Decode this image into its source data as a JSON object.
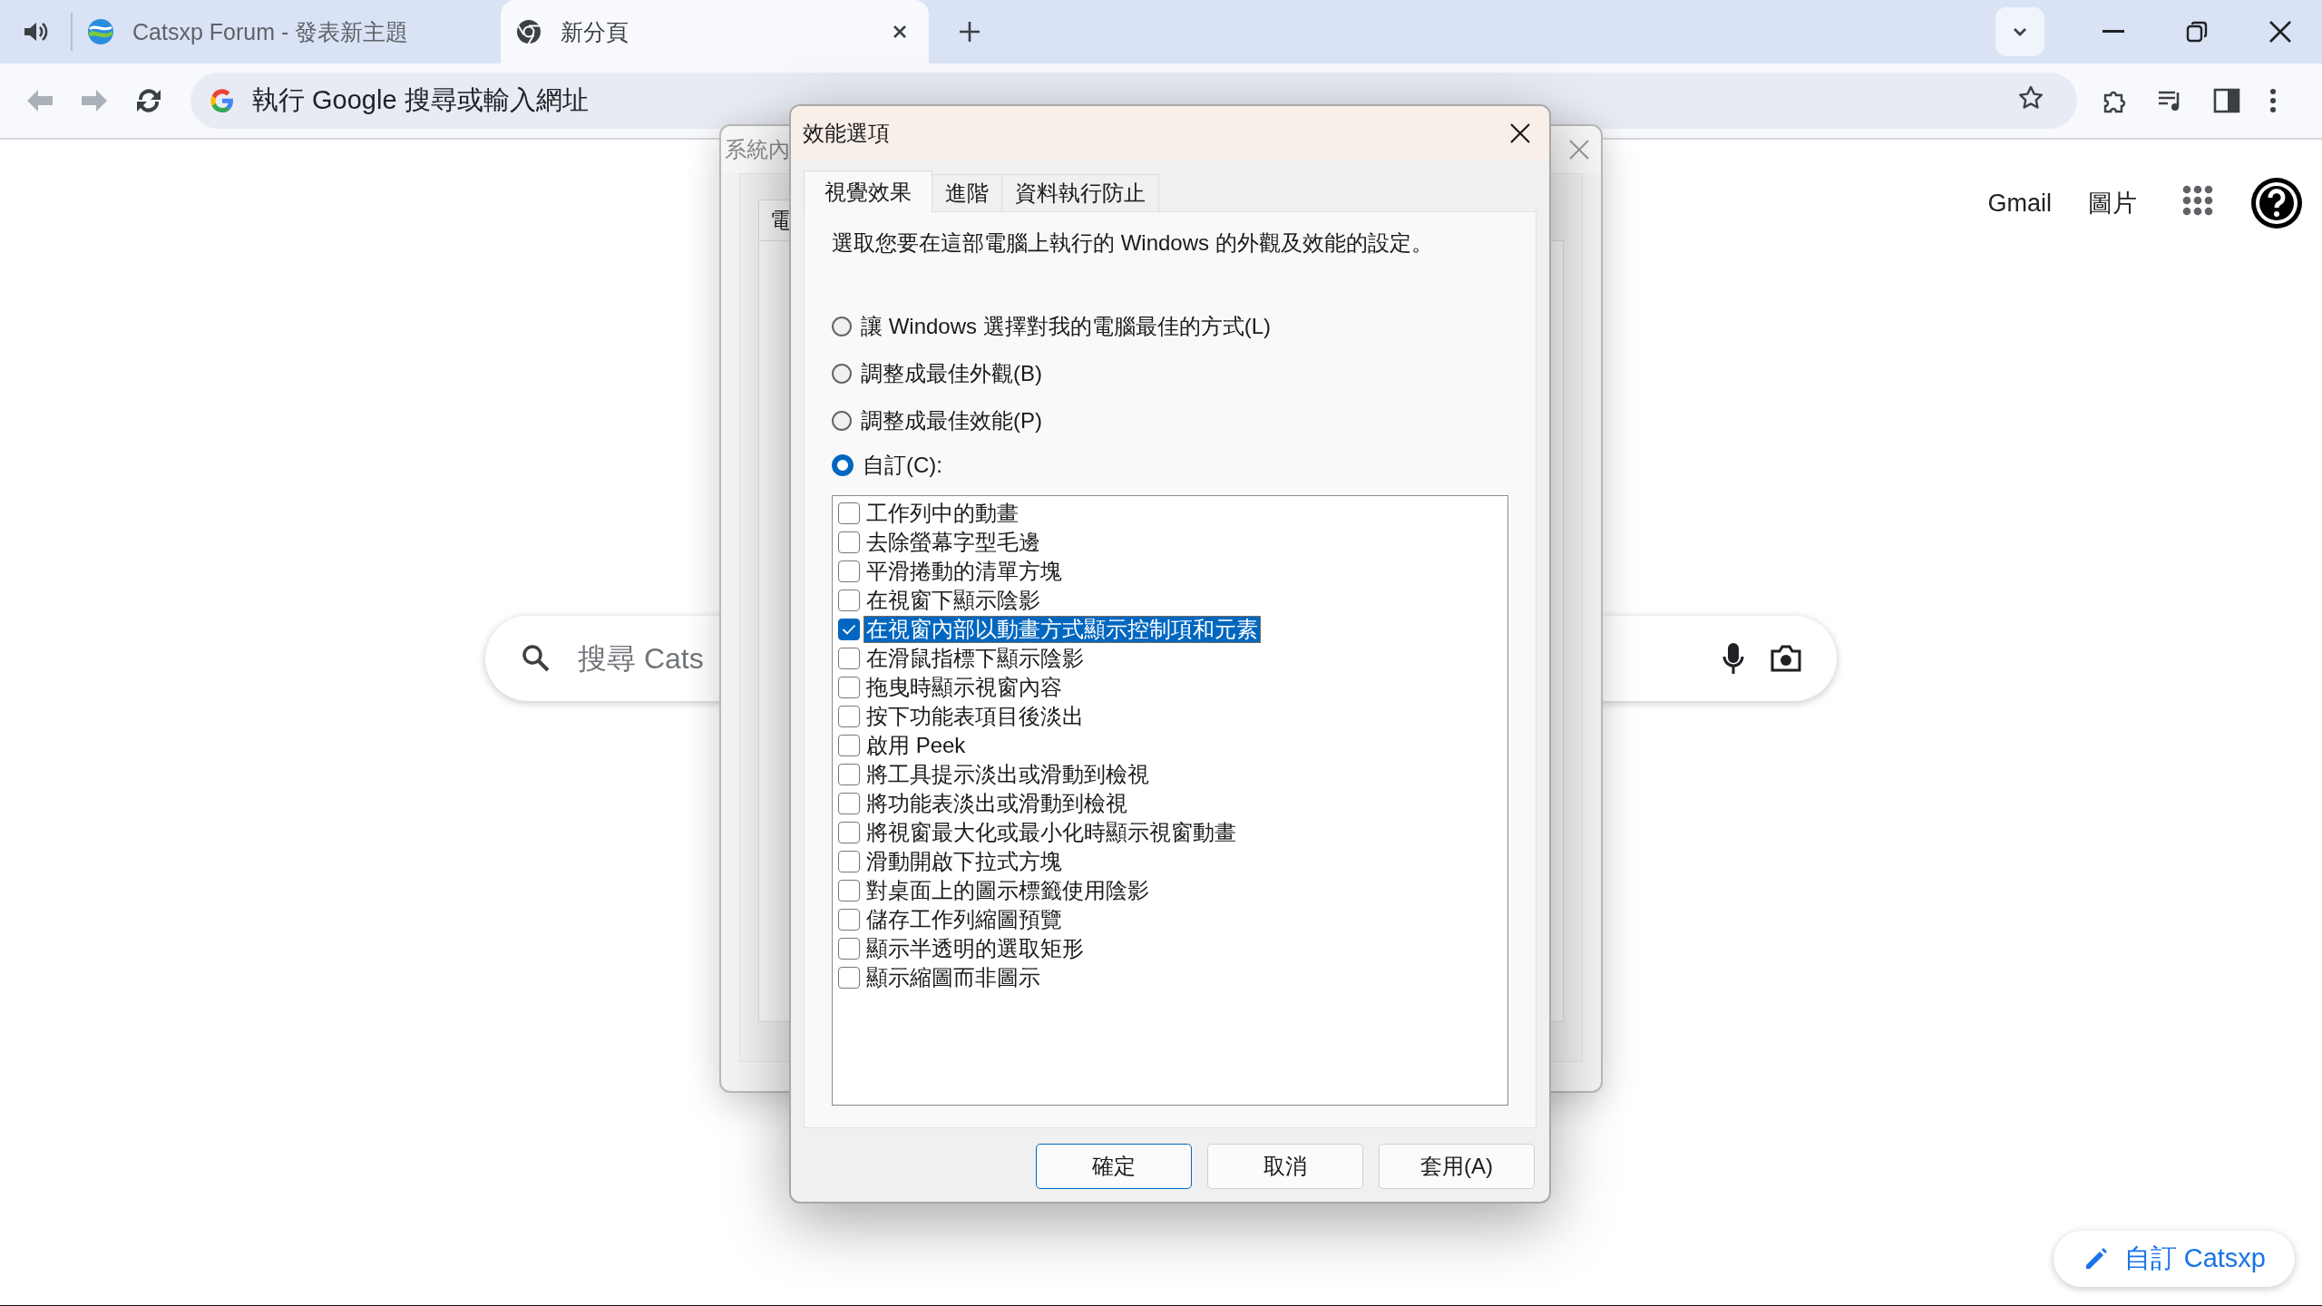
{
  "browser": {
    "tabs": [
      {
        "title": "Catsxp Forum - 發表新主題",
        "selected": false
      },
      {
        "title": "新分頁",
        "selected": true
      }
    ],
    "omnibox": {
      "placeholder": "執行 Google 搜尋或輸入網址"
    }
  },
  "page": {
    "header_links": [
      "Gmail",
      "圖片"
    ],
    "search": {
      "placeholder": "搜尋 Cats"
    },
    "customize_button": "自訂 Catsxp"
  },
  "background_window": {
    "title": "系統內",
    "tab": "電"
  },
  "dialog": {
    "title": "效能選項",
    "tabs": [
      {
        "label": "視覺效果",
        "selected": true
      },
      {
        "label": "進階",
        "selected": false
      },
      {
        "label": "資料執行防止",
        "selected": false
      }
    ],
    "description": "選取您要在這部電腦上執行的 Windows 的外觀及效能的設定。",
    "options": [
      {
        "label": "讓 Windows 選擇對我的電腦最佳的方式(L)",
        "selected": false
      },
      {
        "label": "調整成最佳外觀(B)",
        "selected": false
      },
      {
        "label": "調整成最佳效能(P)",
        "selected": false
      },
      {
        "label": "自訂(C):",
        "selected": true
      }
    ],
    "effects": [
      {
        "label": "工作列中的動畫",
        "checked": false,
        "selected": false
      },
      {
        "label": "去除螢幕字型毛邊",
        "checked": false,
        "selected": false
      },
      {
        "label": "平滑捲動的清單方塊",
        "checked": false,
        "selected": false
      },
      {
        "label": "在視窗下顯示陰影",
        "checked": false,
        "selected": false
      },
      {
        "label": "在視窗內部以動畫方式顯示控制項和元素",
        "checked": true,
        "selected": true
      },
      {
        "label": "在滑鼠指標下顯示陰影",
        "checked": false,
        "selected": false
      },
      {
        "label": "拖曳時顯示視窗內容",
        "checked": false,
        "selected": false
      },
      {
        "label": "按下功能表項目後淡出",
        "checked": false,
        "selected": false
      },
      {
        "label": "啟用 Peek",
        "checked": false,
        "selected": false
      },
      {
        "label": "將工具提示淡出或滑動到檢視",
        "checked": false,
        "selected": false
      },
      {
        "label": "將功能表淡出或滑動到檢視",
        "checked": false,
        "selected": false
      },
      {
        "label": "將視窗最大化或最小化時顯示視窗動畫",
        "checked": false,
        "selected": false
      },
      {
        "label": "滑動開啟下拉式方塊",
        "checked": false,
        "selected": false
      },
      {
        "label": "對桌面上的圖示標籤使用陰影",
        "checked": false,
        "selected": false
      },
      {
        "label": "儲存工作列縮圖預覽",
        "checked": false,
        "selected": false
      },
      {
        "label": "顯示半透明的選取矩形",
        "checked": false,
        "selected": false
      },
      {
        "label": "顯示縮圖而非圖示",
        "checked": false,
        "selected": false
      }
    ],
    "buttons": [
      {
        "label": "確定",
        "default": true
      },
      {
        "label": "取消",
        "default": false
      },
      {
        "label": "套用(A)",
        "default": false
      }
    ]
  }
}
